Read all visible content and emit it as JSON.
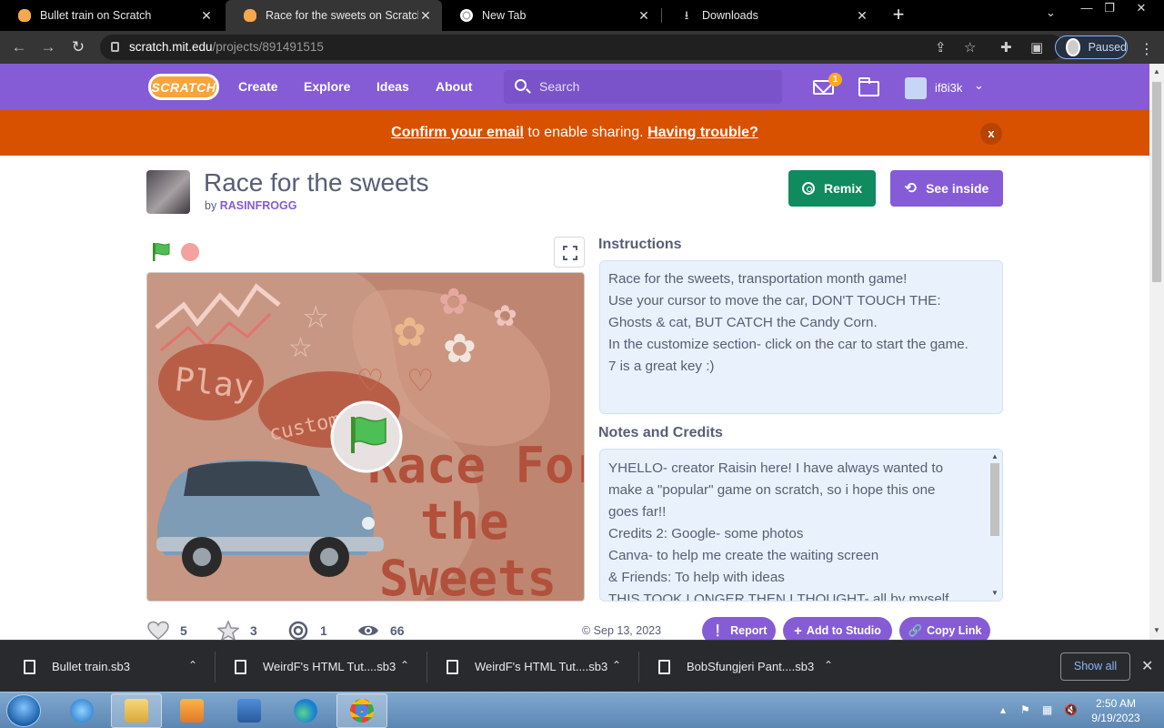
{
  "browser": {
    "tabs": [
      {
        "title": "Bullet train on Scratch",
        "active": false
      },
      {
        "title": "Race for the sweets on Scratch",
        "active": true
      },
      {
        "title": "New Tab",
        "active": false
      },
      {
        "title": "Downloads",
        "active": false
      }
    ],
    "url_host": "scratch.mit.edu",
    "url_path": "/projects/891491515",
    "profile_status": "Paused"
  },
  "nav": {
    "logo": "SCRATCH",
    "links": [
      "Create",
      "Explore",
      "Ideas",
      "About"
    ],
    "search_placeholder": "Search",
    "message_count": "1",
    "username": "if8i3k"
  },
  "banner": {
    "confirm_link": "Confirm your email",
    "middle_text": " to enable sharing. ",
    "trouble_link": "Having trouble?",
    "close": "x"
  },
  "project": {
    "title": "Race for the sweets",
    "by_prefix": "by",
    "author": "RASINFROGG",
    "remix_label": "Remix",
    "see_inside_label": "See inside"
  },
  "stage_art": {
    "play_text": "Play",
    "customize_text": "customize",
    "title_lines": [
      "Race For",
      "the",
      "Sweets"
    ]
  },
  "instructions": {
    "heading": "Instructions",
    "lines": [
      "Race for the sweets, transportation month game!",
      "Use your cursor to move the car, DON'T TOUCH THE:",
      "Ghosts & cat, BUT CATCH the Candy Corn.",
      "In the customize section- click on the car to start the game.",
      "7 is a great key :)"
    ]
  },
  "notes": {
    "heading": "Notes and Credits",
    "lines": [
      "YHELLO- creator Raisin here! I have always wanted to",
      "make a \"popular\" game on scratch, so i hope this one",
      "goes far!!",
      "Credits 2: Google- some photos",
      "Canva- to help me create the waiting screen",
      "& Friends: To help with ideas",
      "THIS TOOK LONGER THEN I THOUGHT- all by myself"
    ]
  },
  "stats": {
    "loves": "5",
    "favorites": "3",
    "remixes": "1",
    "views": "66",
    "date": "© Sep 13, 2023"
  },
  "actions": {
    "report": "Report",
    "add_to_studio": "Add to Studio",
    "copy_link": "Copy Link"
  },
  "downloads": {
    "items": [
      "Bullet train.sb3",
      "WeirdF's HTML Tut....sb3",
      "WeirdF's HTML Tut....sb3",
      "BobSfungjeri Pant....sb3"
    ],
    "show_all": "Show all"
  },
  "taskbar": {
    "time": "2:50 AM",
    "date": "9/19/2023"
  },
  "colors": {
    "scratch_purple": "#855cd6",
    "banner_orange": "#d85100",
    "remix_green": "#0f8b5f",
    "text_slate": "#575e75"
  }
}
